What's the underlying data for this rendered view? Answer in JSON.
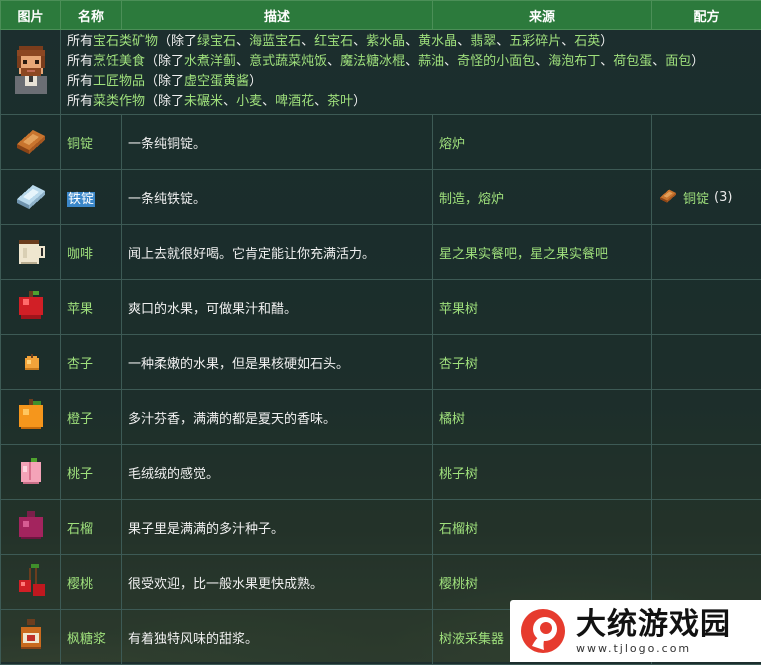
{
  "table": {
    "headers": [
      "图片",
      "名称",
      "描述",
      "来源",
      "配方"
    ],
    "intro": {
      "lines": [
        [
          {
            "t": "所有",
            "c": "w"
          },
          {
            "t": "宝石类矿物",
            "c": "g"
          },
          {
            "t": "（除了",
            "c": "w"
          },
          {
            "t": "绿宝石",
            "c": "g"
          },
          {
            "t": "、",
            "c": "w"
          },
          {
            "t": "海蓝宝石",
            "c": "g"
          },
          {
            "t": "、",
            "c": "w"
          },
          {
            "t": "红宝石",
            "c": "g"
          },
          {
            "t": "、",
            "c": "w"
          },
          {
            "t": "紫水晶",
            "c": "g"
          },
          {
            "t": "、",
            "c": "w"
          },
          {
            "t": "黄水晶",
            "c": "g"
          },
          {
            "t": "、",
            "c": "w"
          },
          {
            "t": "翡翠",
            "c": "g"
          },
          {
            "t": "、",
            "c": "w"
          },
          {
            "t": "五彩碎片",
            "c": "g"
          },
          {
            "t": "、",
            "c": "w"
          },
          {
            "t": "石英",
            "c": "g"
          },
          {
            "t": "）",
            "c": "w"
          }
        ],
        [
          {
            "t": "所有",
            "c": "w"
          },
          {
            "t": "烹饪美食",
            "c": "g"
          },
          {
            "t": "（除了",
            "c": "w"
          },
          {
            "t": "水煮洋蓟",
            "c": "g"
          },
          {
            "t": "、",
            "c": "w"
          },
          {
            "t": "意式蔬菜炖饭",
            "c": "g"
          },
          {
            "t": "、",
            "c": "w"
          },
          {
            "t": "魔法糖冰棍",
            "c": "g"
          },
          {
            "t": "、",
            "c": "w"
          },
          {
            "t": "蒜油",
            "c": "g"
          },
          {
            "t": "、",
            "c": "w"
          },
          {
            "t": "奇怪的小面包",
            "c": "g"
          },
          {
            "t": "、",
            "c": "w"
          },
          {
            "t": "海泡布丁",
            "c": "g"
          },
          {
            "t": "、",
            "c": "w"
          },
          {
            "t": "荷包蛋",
            "c": "g"
          },
          {
            "t": "、",
            "c": "w"
          },
          {
            "t": "面包",
            "c": "g"
          },
          {
            "t": "）",
            "c": "w"
          }
        ],
        [
          {
            "t": "所有",
            "c": "w"
          },
          {
            "t": "工匠物品",
            "c": "g"
          },
          {
            "t": "（除了",
            "c": "w"
          },
          {
            "t": "虚空蛋黄酱",
            "c": "g"
          },
          {
            "t": "）",
            "c": "w"
          }
        ],
        [
          {
            "t": "所有",
            "c": "w"
          },
          {
            "t": "菜类作物",
            "c": "g"
          },
          {
            "t": "（除了",
            "c": "w"
          },
          {
            "t": "未碾米",
            "c": "g"
          },
          {
            "t": "、",
            "c": "w"
          },
          {
            "t": "小麦",
            "c": "g"
          },
          {
            "t": "、",
            "c": "w"
          },
          {
            "t": "啤酒花",
            "c": "g"
          },
          {
            "t": "、",
            "c": "w"
          },
          {
            "t": "茶叶",
            "c": "g"
          },
          {
            "t": "）",
            "c": "w"
          }
        ]
      ]
    },
    "rows": [
      {
        "icon": "copper-bar-icon",
        "name": "铜锭",
        "desc": "一条纯铜锭。",
        "source": "熔炉",
        "source_color": "w",
        "recipe": ""
      },
      {
        "icon": "iron-bar-icon",
        "name": "铁锭",
        "desc": "一条纯铁锭。",
        "source": "制造，熔炉",
        "source_color": "g",
        "recipe": "铜锭",
        "recipe_count": "(3)",
        "highlighted": true
      },
      {
        "icon": "coffee-icon",
        "name": "咖啡",
        "desc": "闻上去就很好喝。它肯定能让你充满活力。",
        "source": "星之果实餐吧，星之果实餐吧",
        "source_color": "g",
        "recipe": ""
      },
      {
        "icon": "apple-icon",
        "name": "苹果",
        "desc": "爽口的水果，可做果汁和醋。",
        "source": "苹果树",
        "source_color": "g",
        "recipe": ""
      },
      {
        "icon": "apricot-icon",
        "name": "杏子",
        "desc": "一种柔嫩的水果，但是果核硬如石头。",
        "source": "杏子树",
        "source_color": "g",
        "recipe": ""
      },
      {
        "icon": "orange-icon",
        "name": "橙子",
        "desc": "多汁芬香，满满的都是夏天的香味。",
        "source": "橘树",
        "source_color": "g",
        "recipe": ""
      },
      {
        "icon": "peach-icon",
        "name": "桃子",
        "desc": "毛绒绒的感觉。",
        "source": "桃子树",
        "source_color": "g",
        "recipe": ""
      },
      {
        "icon": "pomegranate-icon",
        "name": "石榴",
        "desc": "果子里是满满的多汁种子。",
        "source": "石榴树",
        "source_color": "g",
        "recipe": ""
      },
      {
        "icon": "cherry-icon",
        "name": "樱桃",
        "desc": "很受欢迎，比一般水果更快成熟。",
        "source": "樱桃树",
        "source_color": "g",
        "recipe": ""
      },
      {
        "icon": "maple-syrup-icon",
        "name": "枫糖浆",
        "desc": "有着独特风味的甜浆。",
        "source": "树液采集器",
        "source_color": "g",
        "recipe": ""
      }
    ]
  },
  "watermark": {
    "title": "大统游戏园",
    "url": "www.tjlogo.com"
  }
}
